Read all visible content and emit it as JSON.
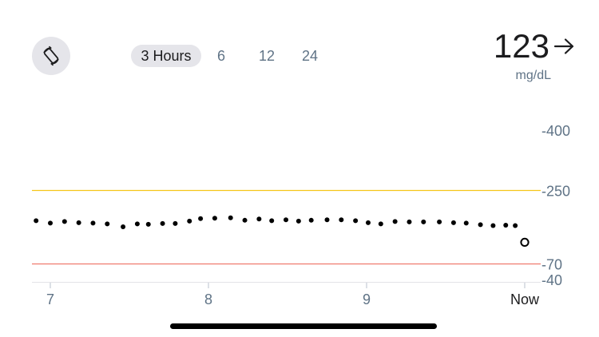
{
  "header": {
    "rotate_button": {
      "icon": "rotate-screen-icon"
    },
    "range_tabs": [
      {
        "label": "3 Hours",
        "selected": true
      },
      {
        "label": "6",
        "selected": false
      },
      {
        "label": "12",
        "selected": false
      },
      {
        "label": "24",
        "selected": false
      }
    ],
    "reading": {
      "value": "123",
      "trend_icon": "arrow-right-icon",
      "unit": "mg/dL"
    }
  },
  "colors": {
    "high_target": "#f5c518",
    "low_target": "#f07a6e",
    "axis_text": "#5f7386",
    "dots": "#000000",
    "tab_selected_bg": "#e5e5ea"
  },
  "chart_data": {
    "type": "scatter",
    "title": "",
    "xlabel": "",
    "ylabel": "",
    "y_scale": "nonlinear-piecewise",
    "y_ticks": [
      400,
      250,
      70,
      40
    ],
    "y_tick_labels": [
      "-400",
      "-250",
      "-70",
      "-40"
    ],
    "x_ticks": [
      7,
      8,
      9,
      10
    ],
    "x_tick_labels": [
      "7",
      "8",
      "9",
      "Now"
    ],
    "xlim": [
      6.88,
      10.0
    ],
    "high_threshold": 250,
    "low_threshold": 70,
    "grid": false,
    "legend": "none",
    "series": [
      {
        "x": [
          6.91,
          7.0,
          7.09,
          7.18,
          7.27,
          7.36,
          7.46,
          7.55,
          7.62,
          7.71,
          7.79,
          7.88,
          7.95,
          8.04,
          8.14,
          8.23,
          8.32,
          8.4,
          8.49,
          8.57,
          8.65,
          8.75,
          8.84,
          8.93,
          9.01,
          9.09,
          9.18,
          9.27,
          9.36,
          9.46,
          9.55,
          9.63,
          9.72,
          9.8,
          9.88,
          9.94
        ],
        "y": [
          176,
          170,
          174,
          171,
          170,
          168,
          161,
          168,
          167,
          169,
          169,
          175,
          181,
          182,
          183,
          177,
          180,
          176,
          178,
          175,
          177,
          178,
          178,
          176,
          171,
          168,
          174,
          173,
          173,
          173,
          171,
          170,
          166,
          164,
          165,
          164
        ]
      }
    ],
    "current": {
      "x": 10.0,
      "y": 123
    }
  }
}
